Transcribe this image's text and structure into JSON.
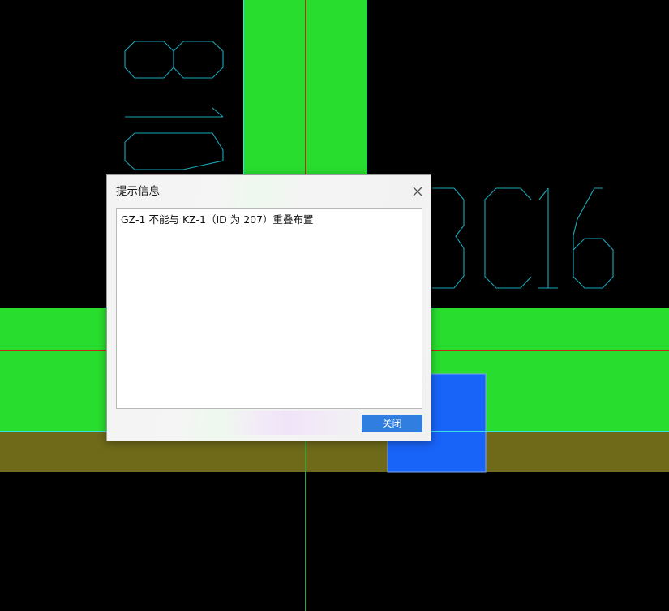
{
  "dialog": {
    "title": "提示信息",
    "message": "GZ-1 不能与 KZ-1（ID 为 207）重叠布置",
    "close_button_label": "关闭"
  },
  "drawing": {
    "labels": {
      "rebar_vertical": "C18",
      "rebar_horizontal": "3C16"
    },
    "colors": {
      "background": "#000000",
      "beam_fill": "#29dd2e",
      "beam_edge": "#3de0e8",
      "slab_band": "#6e6a1a",
      "axis_red": "#c8261a",
      "axis_green": "#1fae3a",
      "column_blue": "#1863f8",
      "text_cyan": "#19a8b8"
    },
    "icons": {
      "close": "close-x-icon"
    }
  }
}
